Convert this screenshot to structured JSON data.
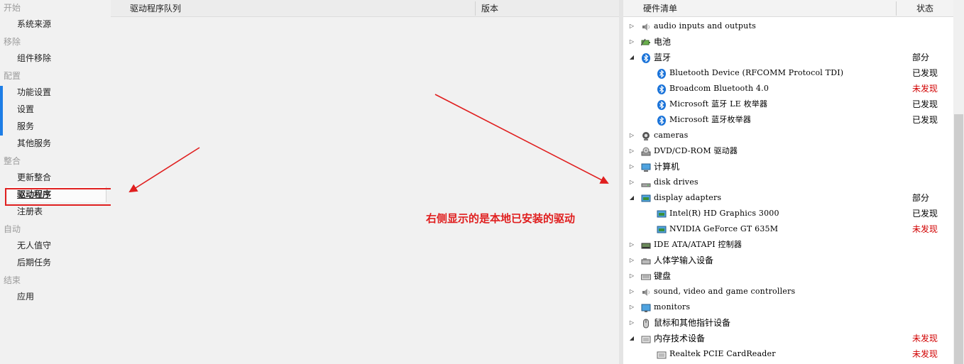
{
  "sidebar": {
    "sections": [
      {
        "label": "开始",
        "items": [
          "系统来源"
        ]
      },
      {
        "label": "移除",
        "items": [
          "组件移除"
        ]
      },
      {
        "label": "配置",
        "items": [
          "功能设置",
          "设置",
          "服务",
          "其他服务"
        ]
      },
      {
        "label": "整合",
        "items": [
          "更新整合",
          "驱动程序",
          "注册表"
        ]
      },
      {
        "label": "自动",
        "items": [
          "无人值守",
          "后期任务"
        ]
      },
      {
        "label": "结束",
        "items": [
          "应用"
        ]
      }
    ],
    "selected": "驱动程序"
  },
  "queue_panel": {
    "col_name": "驱动程序队列",
    "col_version": "版本"
  },
  "hardware_panel": {
    "col_name": "硬件清单",
    "col_status": "状态",
    "rows": [
      {
        "label": "audio inputs and outputs",
        "icon": "speaker-icon",
        "level": 0,
        "expand": "collapsed",
        "status": "",
        "status_color": ""
      },
      {
        "label": "电池",
        "icon": "battery-icon",
        "level": 0,
        "expand": "collapsed",
        "status": "",
        "status_color": ""
      },
      {
        "label": "蓝牙",
        "icon": "bluetooth-icon",
        "level": 0,
        "expand": "expanded",
        "status": "部分",
        "status_color": "#000000"
      },
      {
        "label": "Bluetooth Device (RFCOMM Protocol TDI)",
        "icon": "bluetooth-icon",
        "level": 1,
        "expand": "none",
        "status": "已发现",
        "status_color": "#000000"
      },
      {
        "label": "Broadcom Bluetooth 4.0",
        "icon": "bluetooth-icon",
        "level": 1,
        "expand": "none",
        "status": "未发现",
        "status_color": "#d10000"
      },
      {
        "label": "Microsoft 蓝牙 LE 枚举器",
        "icon": "bluetooth-icon",
        "level": 1,
        "expand": "none",
        "status": "已发现",
        "status_color": "#000000"
      },
      {
        "label": "Microsoft 蓝牙枚举器",
        "icon": "bluetooth-icon",
        "level": 1,
        "expand": "none",
        "status": "已发现",
        "status_color": "#000000"
      },
      {
        "label": "cameras",
        "icon": "camera-icon",
        "level": 0,
        "expand": "collapsed",
        "status": "",
        "status_color": ""
      },
      {
        "label": "DVD/CD-ROM 驱动器",
        "icon": "disc-drive-icon",
        "level": 0,
        "expand": "collapsed",
        "status": "",
        "status_color": ""
      },
      {
        "label": "计算机",
        "icon": "computer-icon",
        "level": 0,
        "expand": "collapsed",
        "status": "",
        "status_color": ""
      },
      {
        "label": "disk drives",
        "icon": "disk-drive-icon",
        "level": 0,
        "expand": "collapsed",
        "status": "",
        "status_color": ""
      },
      {
        "label": "display adapters",
        "icon": "display-adapter-icon",
        "level": 0,
        "expand": "expanded",
        "status": "部分",
        "status_color": "#000000"
      },
      {
        "label": "Intel(R) HD Graphics 3000",
        "icon": "display-adapter-icon",
        "level": 1,
        "expand": "none",
        "status": "已发现",
        "status_color": "#000000"
      },
      {
        "label": "NVIDIA GeForce GT 635M",
        "icon": "display-adapter-icon",
        "level": 1,
        "expand": "none",
        "status": "未发现",
        "status_color": "#d10000"
      },
      {
        "label": "IDE ATA/ATAPI 控制器",
        "icon": "ide-controller-icon",
        "level": 0,
        "expand": "collapsed",
        "status": "",
        "status_color": ""
      },
      {
        "label": "人体学输入设备",
        "icon": "hid-icon",
        "level": 0,
        "expand": "collapsed",
        "status": "",
        "status_color": ""
      },
      {
        "label": "键盘",
        "icon": "keyboard-icon",
        "level": 0,
        "expand": "collapsed",
        "status": "",
        "status_color": ""
      },
      {
        "label": "sound, video and game controllers",
        "icon": "speaker-icon",
        "level": 0,
        "expand": "collapsed",
        "status": "",
        "status_color": ""
      },
      {
        "label": "monitors",
        "icon": "monitor-icon",
        "level": 0,
        "expand": "collapsed",
        "status": "",
        "status_color": ""
      },
      {
        "label": "鼠标和其他指针设备",
        "icon": "mouse-icon",
        "level": 0,
        "expand": "collapsed",
        "status": "",
        "status_color": ""
      },
      {
        "label": "内存技术设备",
        "icon": "memory-device-icon",
        "level": 0,
        "expand": "expanded",
        "status": "未发现",
        "status_color": "#d10000"
      },
      {
        "label": "Realtek PCIE CardReader",
        "icon": "memory-device-icon",
        "level": 1,
        "expand": "none",
        "status": "未发现",
        "status_color": "#d10000"
      }
    ]
  },
  "annotation": {
    "text": "右侧显示的是本地已安装的驱动"
  },
  "colors": {
    "accent": "#1e7ee6",
    "annotation_red": "#e01f1f",
    "status_red": "#d10000",
    "bluetooth_blue": "#1a73d9"
  }
}
